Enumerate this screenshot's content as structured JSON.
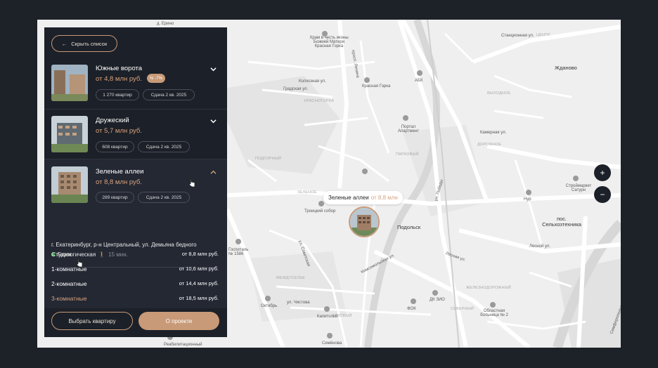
{
  "panel": {
    "hide_label": "Скрыть список",
    "complexes": [
      {
        "name": "Южные ворота",
        "price": "от 4,8 млн руб.",
        "badge": "-7%",
        "apartments": "1 270 квартир",
        "delivery": "Сдача 2 кв. 2025"
      },
      {
        "name": "Дружеский",
        "price": "от 5,7 млн руб.",
        "apartments": "608 квартир",
        "delivery": "Сдача 2 кв. 2025"
      },
      {
        "name": "Зеленые аллеи",
        "price": "от 8,8 млн руб.",
        "apartments": "289 квартир",
        "delivery": "Сдача 2 кв. 2025"
      }
    ],
    "address": "г. Екатеринбург, р-н Центральный, ул. Демьяна бедного",
    "metro": {
      "station": "Геологическая",
      "time": "15 мин."
    },
    "flats": [
      {
        "type": "Студии",
        "price": "от 8,8 млн руб."
      },
      {
        "type": "1-комнатные",
        "price": "от 10,6 млн руб."
      },
      {
        "type": "2-комнатные",
        "price": "от 14,4 млн руб."
      },
      {
        "type": "3-комнатные",
        "price": "от 18,5 млн руб."
      }
    ],
    "choose_label": "Выбрать квартиру",
    "about_label": "О проекте"
  },
  "map": {
    "tooltip_name": "Зеленые аллеи",
    "tooltip_price": "от 8,8 млн",
    "zoom_in": "+",
    "zoom_out": "−",
    "labels": {
      "erino": "д. Ерино",
      "krasnaya_gorka_church": "Храм в честь иконы Божией Матери Красная Горка",
      "kolkhoznaya": "Колхозная ул.",
      "gradskaya": "Градская ул.",
      "krasnaya_gorka": "Красная Горка",
      "krasnogorka": "КРАСНОГОРКА",
      "abk": "АБК",
      "zhdanovo": "Жданово",
      "portal": "Портал Апартмент",
      "podgorny": "ПОДГОРНЫЙ",
      "zelenoye": "ЗЕЛЕНОЕ",
      "troitsky": "Троицкий собор",
      "podolsk": "Подольск",
      "vykhodnoe": "ВЫХОДНОЕ",
      "kamernaya": "Камерная ул.",
      "dorozhnoe": "ДОРОЖНОЕ",
      "stroymarket": "Строймаркет Сатурн",
      "nur": "Нур",
      "selkhoztekhnika": "пос. Сельхозтехника",
      "hospital": "Госпиталь № 1586",
      "mezhdu": "МЕЖДУСЕЛЬЕ",
      "oktyabr": "Октябрь",
      "kapitoliy": "Капитолий",
      "fok": "ФОК",
      "dk_zio": "ДК ЗИО",
      "severny": "СЕВЕРНЫЙ",
      "oblast_hospital": "Областная больница № 2",
      "semenova": "Семёнова",
      "reab": "Реабилитационный",
      "komsomolskaya": "Комсомольская ул.",
      "lesnaya": "Лесная ул.",
      "chistova": "ул. Чистова",
      "simferopol": "Симферопольское",
      "parkovy": "ПАРКОВЫЙ",
      "lenina": "просп. Ленина",
      "sovetskaya": "ул. Советская",
      "pobedy": "ул. Победы",
      "lesnaya2": "Лесной ул.",
      "zheleznodor": "ЖЕЛЕЗНОДОРОЖНЫЙ",
      "stantsionnaya": "Станционная ул.",
      "tsentr": "ЦЕНТР",
      "gazovy": "ГАЗОВЫЙ"
    }
  },
  "colors": {
    "accent": "#c89a78",
    "panel_bg": "#1c2028",
    "frame": "#1d2128",
    "metro": "#3fb54f"
  }
}
